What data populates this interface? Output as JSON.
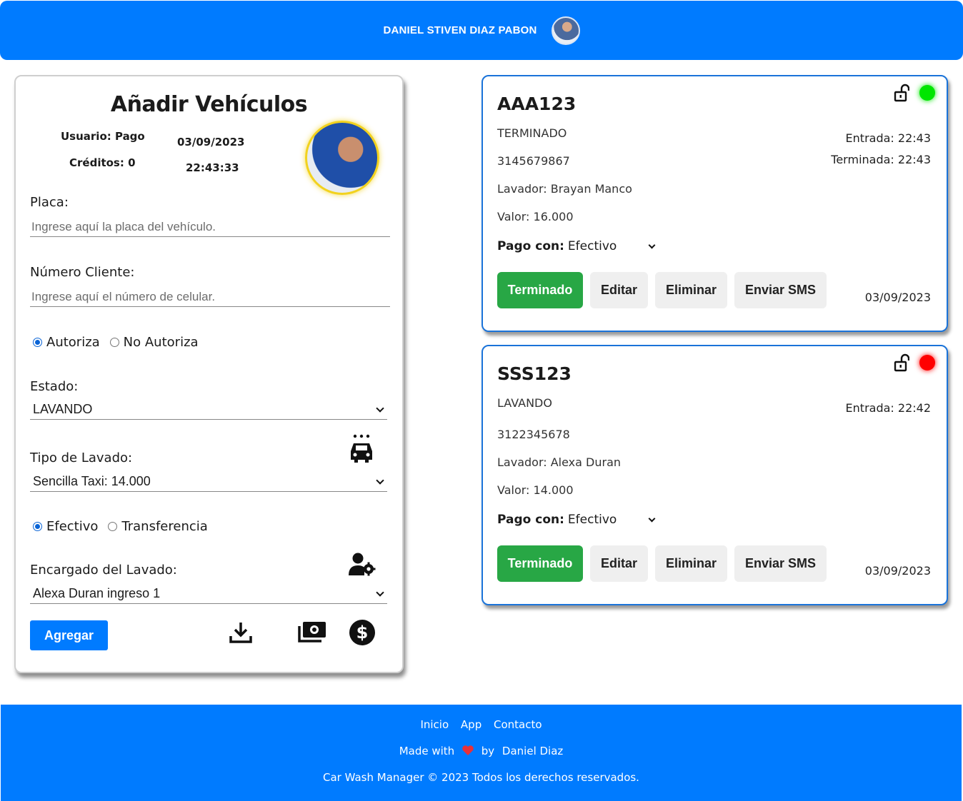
{
  "header": {
    "username": "DANIEL STIVEN DIAZ PABON"
  },
  "form": {
    "title": "Añadir Vehículos",
    "usuario": "Usuario: Pago",
    "creditos": "Créditos: 0",
    "date": "03/09/2023",
    "time": "22:43:33",
    "placa_label": "Placa:",
    "placa_placeholder": "Ingrese aquí la placa del vehículo.",
    "numero_label": "Número Cliente:",
    "numero_placeholder": "Ingrese aquí el número de celular.",
    "autoriza": "Autoriza",
    "no_autoriza": "No Autoriza",
    "estado_label": "Estado:",
    "estado_value": "LAVANDO",
    "tipo_label": "Tipo de Lavado:",
    "tipo_value": "Sencilla Taxi: 14.000",
    "efectivo": "Efectivo",
    "transferencia": "Transferencia",
    "encargado_label": "Encargado del Lavado:",
    "encargado_value": "Alexa Duran ingreso 1",
    "agregar": "Agregar"
  },
  "vehicles": [
    {
      "plate": "AAA123",
      "status": "TERMINADO",
      "phone": "3145679867",
      "lavador": "Lavador: Brayan Manco",
      "valor": "Valor: 16.000",
      "pago_label": "Pago con:",
      "pago_value": "Efectivo",
      "entrada": "Entrada: 22:43",
      "terminada": "Terminada: 22:43",
      "date": "03/09/2023",
      "indicator_color": "#00e600"
    },
    {
      "plate": "SSS123",
      "status": "LAVANDO",
      "phone": "3122345678",
      "lavador": "Lavador: Alexa Duran",
      "valor": "Valor: 14.000",
      "pago_label": "Pago con:",
      "pago_value": "Efectivo",
      "entrada": "Entrada: 22:42",
      "date": "03/09/2023",
      "indicator_color": "#ff0000"
    }
  ],
  "buttons": {
    "terminado": "Terminado",
    "editar": "Editar",
    "eliminar": "Eliminar",
    "enviar_sms": "Enviar SMS"
  },
  "footer": {
    "links": [
      "Inicio",
      "App",
      "Contacto"
    ],
    "made_prefix": "Made with",
    "made_by": "by",
    "author": "Daniel Diaz",
    "copyright": "Car Wash Manager © 2023 Todos los derechos reservados."
  }
}
